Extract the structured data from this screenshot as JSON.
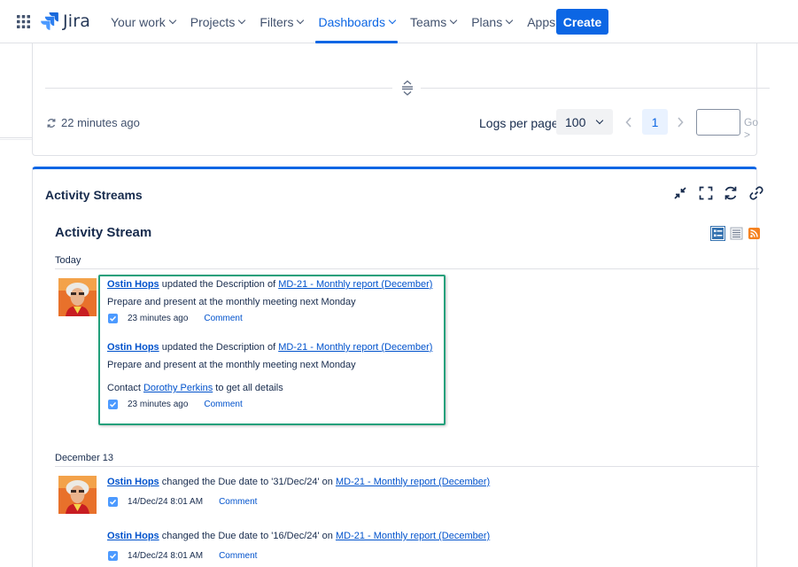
{
  "nav": {
    "logo_text": "Jira",
    "items": [
      {
        "label": "Your work"
      },
      {
        "label": "Projects"
      },
      {
        "label": "Filters"
      },
      {
        "label": "Dashboards"
      },
      {
        "label": "Teams"
      },
      {
        "label": "Plans"
      },
      {
        "label": "Apps"
      }
    ],
    "active_index": 3,
    "create_label": "Create"
  },
  "top_panel": {
    "updated_text": "22 minutes ago",
    "logs_per_page_label": "Logs per page:",
    "logs_per_page_value": "100",
    "current_page": "1",
    "page_input_value": "",
    "go_label": "Go >"
  },
  "gadget": {
    "title": "Activity Streams",
    "stream_title": "Activity Stream",
    "groups": [
      {
        "date": "Today",
        "entries": [
          {
            "author": "Ostin Hops",
            "action": " updated the Description of ",
            "issue": "MD-21 - Monthly report (December)",
            "lines": [
              "Prepare and present at the monthly meeting next Monday"
            ],
            "time": "23 minutes ago",
            "comment": "Comment"
          },
          {
            "author": "Ostin Hops",
            "action": " updated the Description of ",
            "issue": "MD-21 - Monthly report (December)",
            "lines": [
              "Prepare and present at the monthly meeting next Monday"
            ],
            "contact_prefix": "Contact ",
            "contact_name": "Dorothy Perkins",
            "contact_suffix": " to get all details",
            "time": "23 minutes ago",
            "comment": "Comment"
          }
        ]
      },
      {
        "date": "December 13",
        "entries": [
          {
            "author": "Ostin Hops",
            "action": " changed the Due date to '31/Dec/24' on ",
            "issue": "MD-21 - Monthly report (December)",
            "time": "14/Dec/24 8:01 AM",
            "comment": "Comment"
          },
          {
            "author": "Ostin Hops",
            "action": " changed the Due date to '16/Dec/24' on ",
            "issue": "MD-21 - Monthly report (December)",
            "time": "14/Dec/24 8:01 AM",
            "comment": "Comment"
          }
        ]
      }
    ]
  },
  "colors": {
    "accent": "#0c66e4",
    "highlight": "#22a07b",
    "link": "#0052cc"
  },
  "icons": [
    "app-grid-icon",
    "jira-logo-icon",
    "resize-handle-icon",
    "refresh-icon",
    "chevron-left-icon",
    "chevron-right-icon",
    "minimize-icon",
    "fullscreen-icon",
    "refresh-gadget-icon",
    "link-icon",
    "full-view-icon",
    "list-view-icon",
    "rss-feed-icon",
    "checkbox-icon"
  ]
}
